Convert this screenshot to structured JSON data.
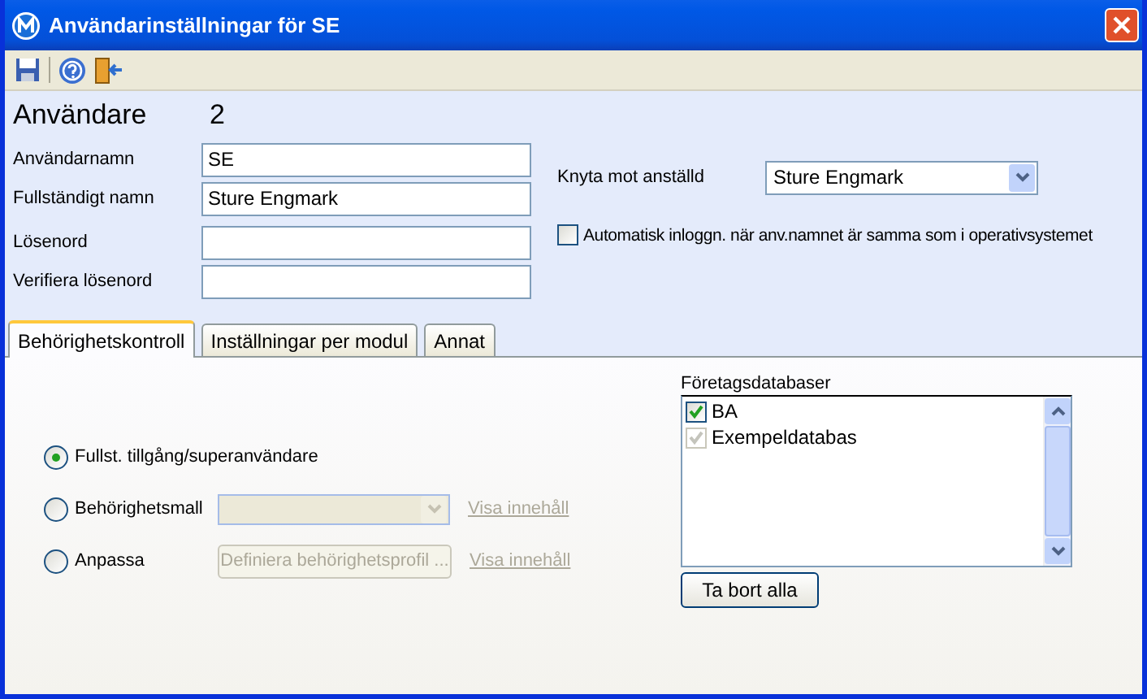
{
  "window": {
    "title": "Användarinställningar för SE"
  },
  "header": {
    "label": "Användare",
    "number": "2"
  },
  "fields": [
    {
      "label": "Användarnamn",
      "value": "SE"
    },
    {
      "label": "Fullständigt namn",
      "value": "Sture Engmark"
    },
    {
      "label": "Lösenord"
    },
    {
      "label": "Verifiera lösenord"
    }
  ],
  "employee": {
    "label": "Knyta mot anställd",
    "value": "Sture Engmark"
  },
  "auto_login": {
    "label": "Automatisk inloggn. när anv.namnet är samma som i operativsystemet",
    "checked": false
  },
  "tabs": [
    {
      "label": "Behörighetskontroll",
      "selected": true
    },
    {
      "label": "Inställningar per modul",
      "selected": false
    },
    {
      "label": "Annat",
      "selected": false
    }
  ],
  "access": [
    {
      "label": "Fullst. tillgång/superanvändare",
      "selected": true,
      "kind": "plain"
    },
    {
      "label": "Behörighetsmall",
      "selected": false,
      "kind": "dropdown",
      "link": "Visa innehåll"
    },
    {
      "label": "Anpassa",
      "selected": false,
      "kind": "button",
      "button": "Definiera behörighetsprofil ...",
      "link": "Visa innehåll"
    }
  ],
  "databases": {
    "label": "Företagsdatabaser",
    "items": [
      {
        "name": "BA",
        "checked": true,
        "disabled": false
      },
      {
        "name": "Exempeldatabas",
        "checked": true,
        "disabled": true
      }
    ],
    "button": "Ta bort alla"
  }
}
